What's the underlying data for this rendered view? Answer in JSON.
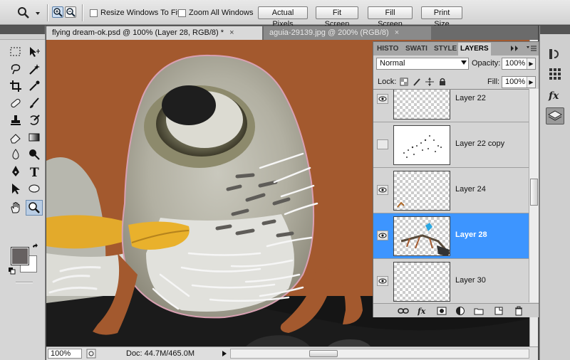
{
  "options_bar": {
    "resize_windows_label": "Resize Windows To Fit",
    "zoom_all_label": "Zoom All Windows",
    "actual_pixels_label": "Actual Pixels",
    "fit_screen_label": "Fit Screen",
    "fill_screen_label": "Fill Screen",
    "print_size_label": "Print Size"
  },
  "tabs": [
    {
      "title": "flying dream-ok.psd @ 100% (Layer 28, RGB/8) *",
      "close": "×"
    },
    {
      "title": "aguia-29139.jpg @ 200% (RGB/8)",
      "close": "×"
    }
  ],
  "status": {
    "zoom": "100%",
    "doc": "Doc: 44.7M/465.0M"
  },
  "layers_panel": {
    "tabs": [
      "HISTO",
      "SWATI",
      "STYLE",
      "LAYERS"
    ],
    "blend_mode": "Normal",
    "opacity_label": "Opacity:",
    "opacity_value": "100%",
    "lock_label": "Lock:",
    "fill_label": "Fill:",
    "fill_value": "100%",
    "layers": [
      {
        "name": "Layer 22",
        "visible": true,
        "selected": false
      },
      {
        "name": "Layer 22 copy",
        "visible": false,
        "selected": false
      },
      {
        "name": "Layer 24",
        "visible": true,
        "selected": false
      },
      {
        "name": "Layer 28",
        "visible": true,
        "selected": true
      },
      {
        "name": "Layer 30",
        "visible": true,
        "selected": false
      }
    ]
  },
  "colors": {
    "canvas_bg": "#a3592e",
    "selection_blue": "#3d95ff",
    "foreground_color": "#666161",
    "background_color": "#ffffff"
  }
}
